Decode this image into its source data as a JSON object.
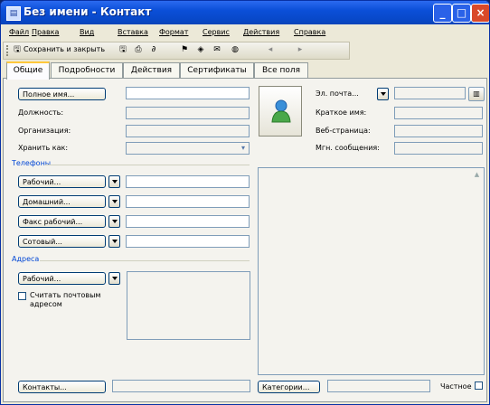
{
  "window": {
    "title": "Без имени - Контакт",
    "app_icon": "contact-card-icon",
    "controls": {
      "minimize": "_",
      "maximize": "□",
      "close": "×"
    }
  },
  "menu": [
    "Файл",
    "Правка",
    "Вид",
    "Вставка",
    "Формат",
    "Сервис",
    "Действия",
    "Справка"
  ],
  "toolbar": {
    "save_close_label": "Сохранить и закрыть",
    "icons": [
      "save-icon",
      "print-icon",
      "attach-icon",
      "flag-icon",
      "categories-icon",
      "envelope-icon",
      "globe-icon",
      "previous-icon",
      "next-icon"
    ]
  },
  "tabs": [
    "Общие",
    "Подробности",
    "Действия",
    "Сертификаты",
    "Все поля"
  ],
  "active_tab": "Общие",
  "general": {
    "full_name_button": "Полное имя...",
    "job_title_label": "Должность:",
    "company_label": "Организация:",
    "file_as_label": "Хранить как:",
    "phones_section": "Телефоны",
    "phones": [
      "Рабочий...",
      "Домашний...",
      "Факс рабочий...",
      "Сотовый..."
    ],
    "addresses_section": "Адреса",
    "address_type_button": "Рабочий...",
    "mailing_address_label": "Считать почтовым адресом",
    "email_button": "Эл. почта...",
    "display_as_label": "Краткое имя:",
    "web_page_label": "Веб-страница:",
    "im_label": "Мгн. сообщения:",
    "contacts_button": "Контакты...",
    "categories_button": "Категории...",
    "private_label": "Частное"
  },
  "colors": {
    "title_bar": "#0b4fd8",
    "window_bg": "#ece9d8",
    "section_blue": "#0046d5",
    "active_tab_accent": "#ffc83c"
  }
}
